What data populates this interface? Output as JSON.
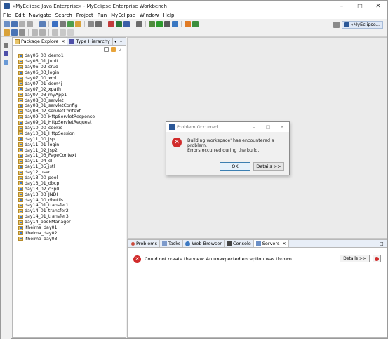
{
  "window": {
    "title": "«MyEclipse Java Enterprise» - MyEclipse Enterprise Workbench",
    "minimize": "–",
    "maximize": "□",
    "close": "✕"
  },
  "menu": [
    "File",
    "Edit",
    "Navigate",
    "Search",
    "Project",
    "Run",
    "MyEclipse",
    "Window",
    "Help"
  ],
  "perspective": {
    "label": "«MyEclipse..."
  },
  "package_explorer": {
    "tabs": [
      {
        "label": "Package Explore",
        "close": "✕",
        "active": true
      },
      {
        "label": "Type Hierarchy",
        "active": false
      }
    ],
    "items": [
      "day06_00_demo1",
      "day06_01_junit",
      "day06_02_crud",
      "day06_03_login",
      "day07_00_xml",
      "day07_01_dom4j",
      "day07_02_xpath",
      "day07_03_myApp1",
      "day08_00_servlet",
      "day08_01_servletConfig",
      "day08_02_servletContext",
      "day09_00_HttpServletResponse",
      "day09_01_HttpServletRequest",
      "day10_00_cookie",
      "day10_01_HttpSession",
      "day11_00_jsp",
      "day11_01_login",
      "day11_02_jsp2",
      "day11_03_PageContext",
      "day11_04_el",
      "day11_05_jstl",
      "day12_user",
      "day13_00_pool",
      "day13_01_dbcp",
      "day13_02_c3p0",
      "day13_03_JNDI",
      "day14_00_dbutils",
      "day14_01_transfer1",
      "day14_01_transfer2",
      "day14_01_transfer3",
      "day14_bookManager",
      "itheima_day01",
      "itheima_day02",
      "itheima_day03"
    ]
  },
  "bottom_panel": {
    "tabs": [
      {
        "label": "Problems"
      },
      {
        "label": "Tasks"
      },
      {
        "label": "Web Browser"
      },
      {
        "label": "Console"
      },
      {
        "label": "Servers",
        "active": true
      }
    ],
    "error_text": "Could not create the view: An unexpected exception was thrown.",
    "details_label": "Details >>"
  },
  "dialog": {
    "title": "Problem Occurred",
    "message": "Building workspace' has encountered a problem.",
    "detail": "Errors occurred during the build.",
    "ok_label": "OK",
    "details_label": "Details >>",
    "minimize": "–",
    "maximize": "□",
    "close": "✕"
  },
  "colors": {
    "error": "#d12b2b",
    "tab_bg": "#e8eef7",
    "accent": "#2b5797"
  }
}
